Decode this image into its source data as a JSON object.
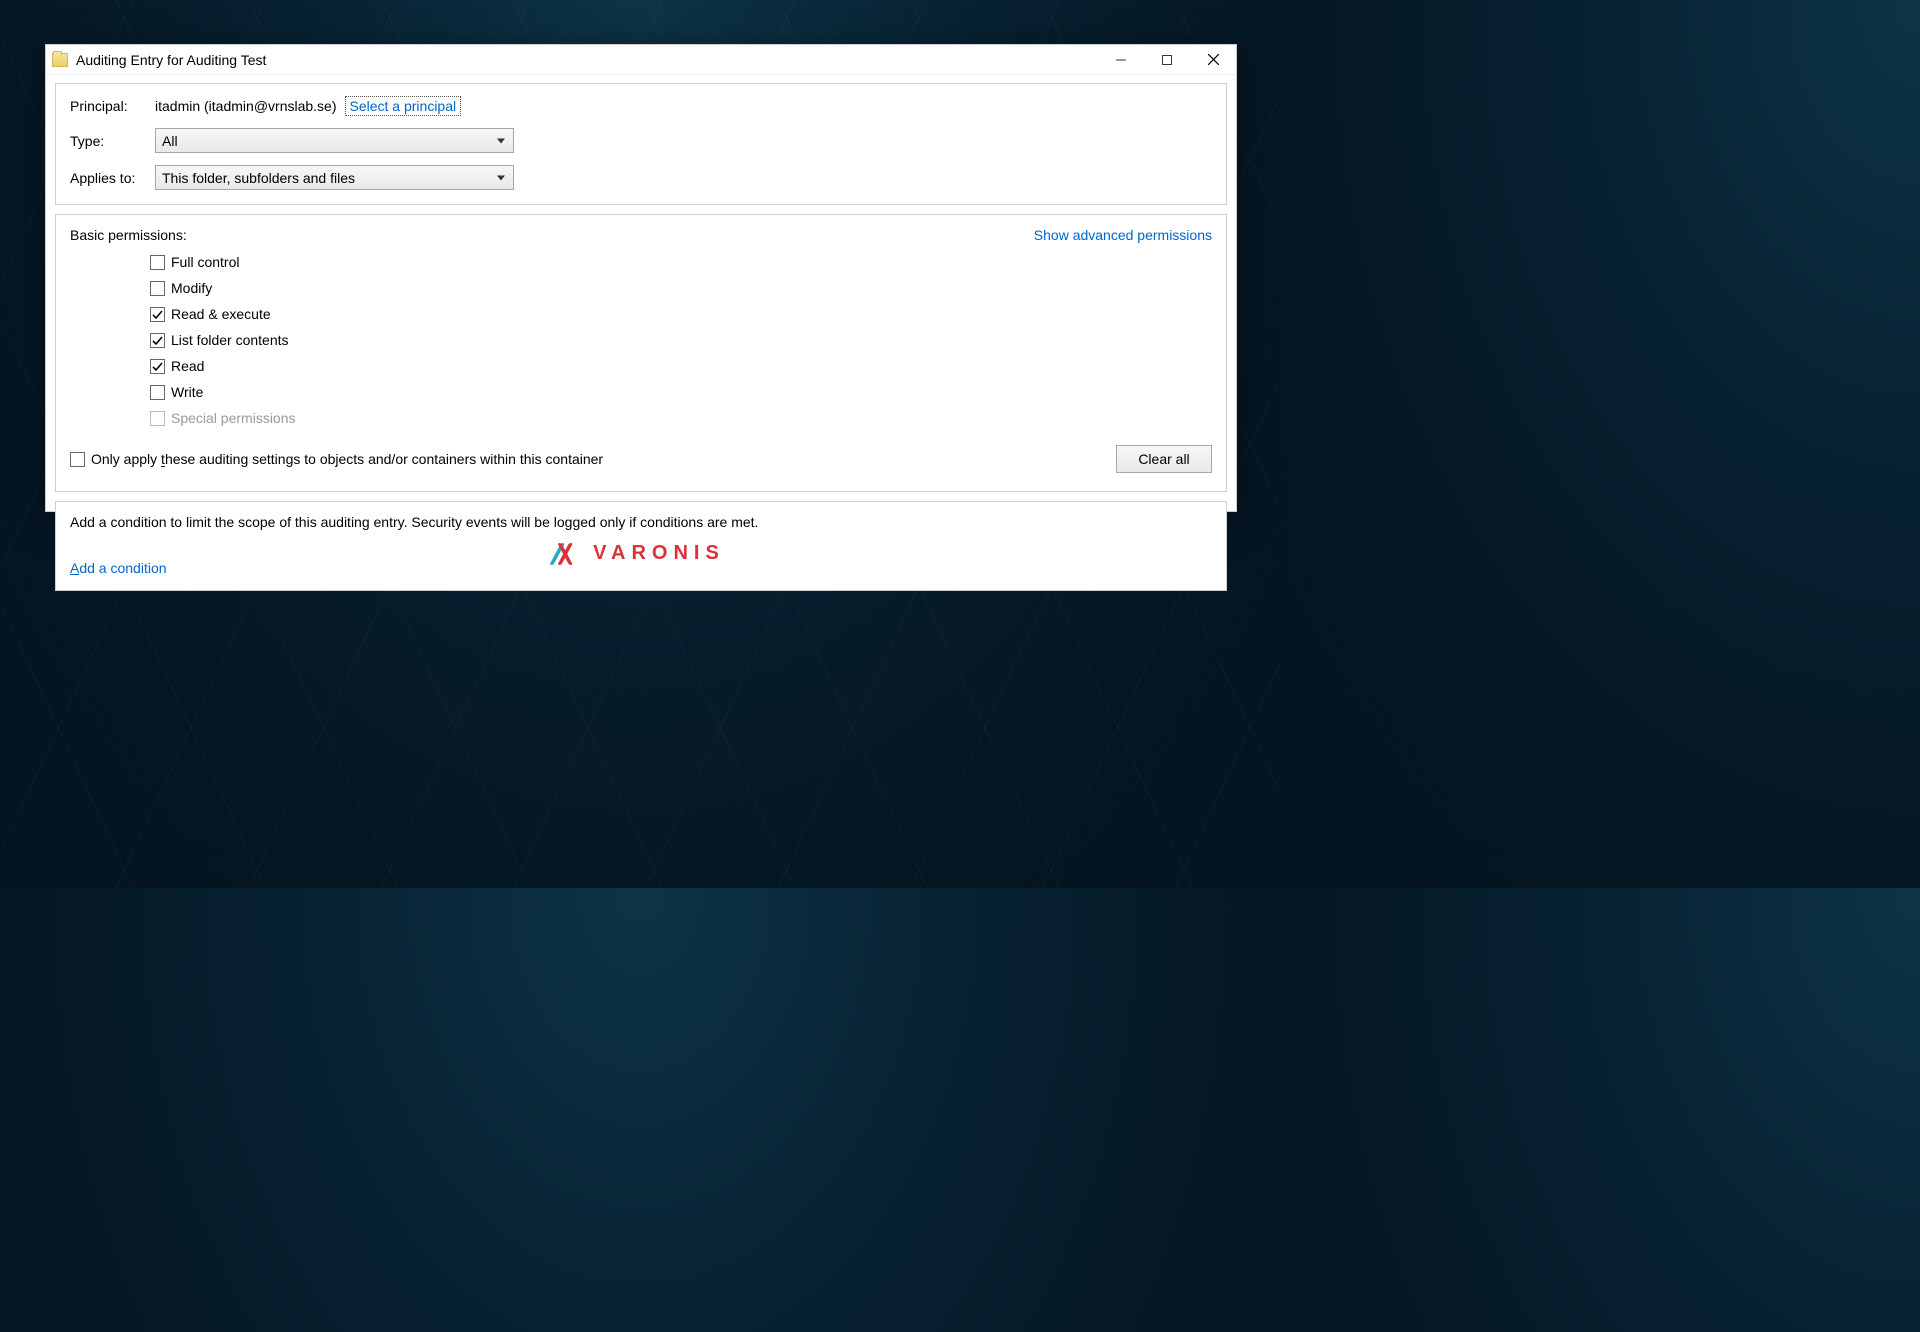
{
  "window": {
    "title": "Auditing Entry for Auditing Test"
  },
  "principal": {
    "label": "Principal:",
    "value": "itadmin (itadmin@vrnslab.se)",
    "select_link": "Select a principal"
  },
  "type": {
    "label": "Type:",
    "value": "All"
  },
  "applies_to": {
    "label": "Applies to:",
    "value": "This folder, subfolders and files"
  },
  "permissions": {
    "header": "Basic permissions:",
    "advanced_link": "Show advanced permissions",
    "items": [
      {
        "label": "Full control",
        "checked": false,
        "disabled": false
      },
      {
        "label": "Modify",
        "checked": false,
        "disabled": false
      },
      {
        "label": "Read & execute",
        "checked": true,
        "disabled": false
      },
      {
        "label": "List folder contents",
        "checked": true,
        "disabled": false
      },
      {
        "label": "Read",
        "checked": true,
        "disabled": false
      },
      {
        "label": "Write",
        "checked": false,
        "disabled": false
      },
      {
        "label": "Special permissions",
        "checked": false,
        "disabled": true
      }
    ],
    "only_apply_prefix": "Only apply ",
    "only_apply_underlined": "t",
    "only_apply_suffix": "hese auditing settings to objects and/or containers within this container",
    "only_apply_checked": false,
    "clear_all": "Clear all"
  },
  "condition": {
    "text": "Add a condition to limit the scope of this auditing entry. Security events will be logged only if conditions are met.",
    "add_link_underlined": "A",
    "add_link_suffix": "dd a condition"
  },
  "brand": {
    "name": "VARONIS"
  }
}
